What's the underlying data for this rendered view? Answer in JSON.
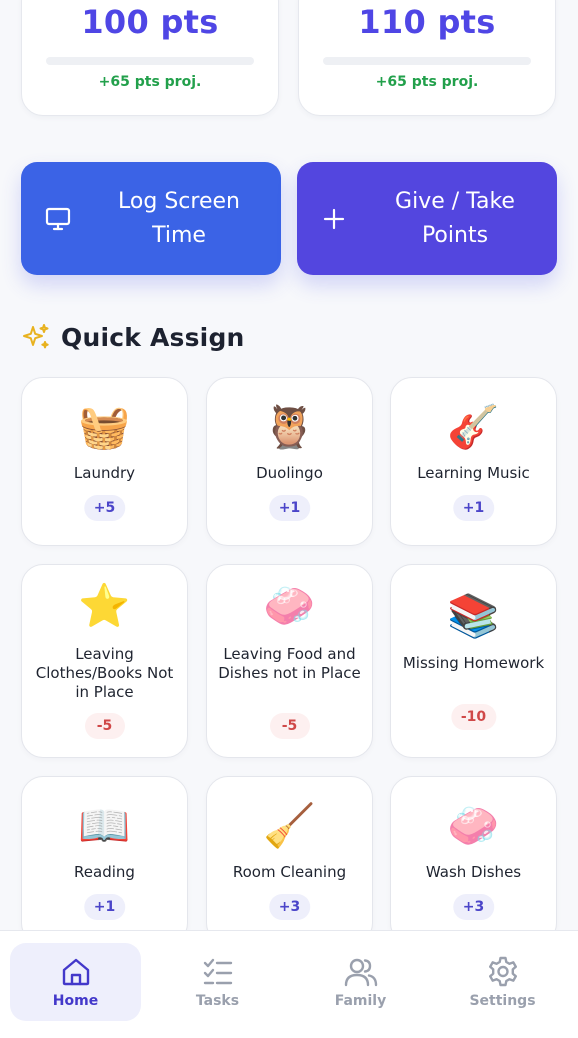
{
  "scores": [
    {
      "points": "100 pts",
      "projection": "+65 pts proj."
    },
    {
      "points": "110 pts",
      "projection": "+65 pts proj."
    }
  ],
  "actions": {
    "log_screen_time": "Log Screen Time",
    "give_take_points": "Give / Take Points"
  },
  "quick_assign": {
    "title": "Quick Assign",
    "tasks": [
      {
        "emoji": "🧺",
        "name": "Laundry",
        "value": "+5"
      },
      {
        "emoji": "🦉",
        "name": "Duolingo",
        "value": "+1"
      },
      {
        "emoji": "🎸",
        "name": "Learning Music",
        "value": "+1"
      },
      {
        "emoji": "⭐",
        "name": "Leaving Clothes/Books Not in Place",
        "value": "-5"
      },
      {
        "emoji": "🧼",
        "name": "Leaving Food and Dishes not in Place",
        "value": "-5"
      },
      {
        "emoji": "📚",
        "name": "Missing Homework",
        "value": "-10"
      },
      {
        "emoji": "📖",
        "name": "Reading",
        "value": "+1"
      },
      {
        "emoji": "🧹",
        "name": "Room Cleaning",
        "value": "+3"
      },
      {
        "emoji": "🧼",
        "name": "Wash Dishes",
        "value": "+3"
      }
    ]
  },
  "nav": {
    "home": "Home",
    "tasks": "Tasks",
    "family": "Family",
    "settings": "Settings",
    "active": "home"
  },
  "colors": {
    "accent": "#4f46e5",
    "log_button": "#3b63e6",
    "give_button": "#5346df",
    "positive_text": "#22a04b",
    "negative_text": "#d04848"
  }
}
